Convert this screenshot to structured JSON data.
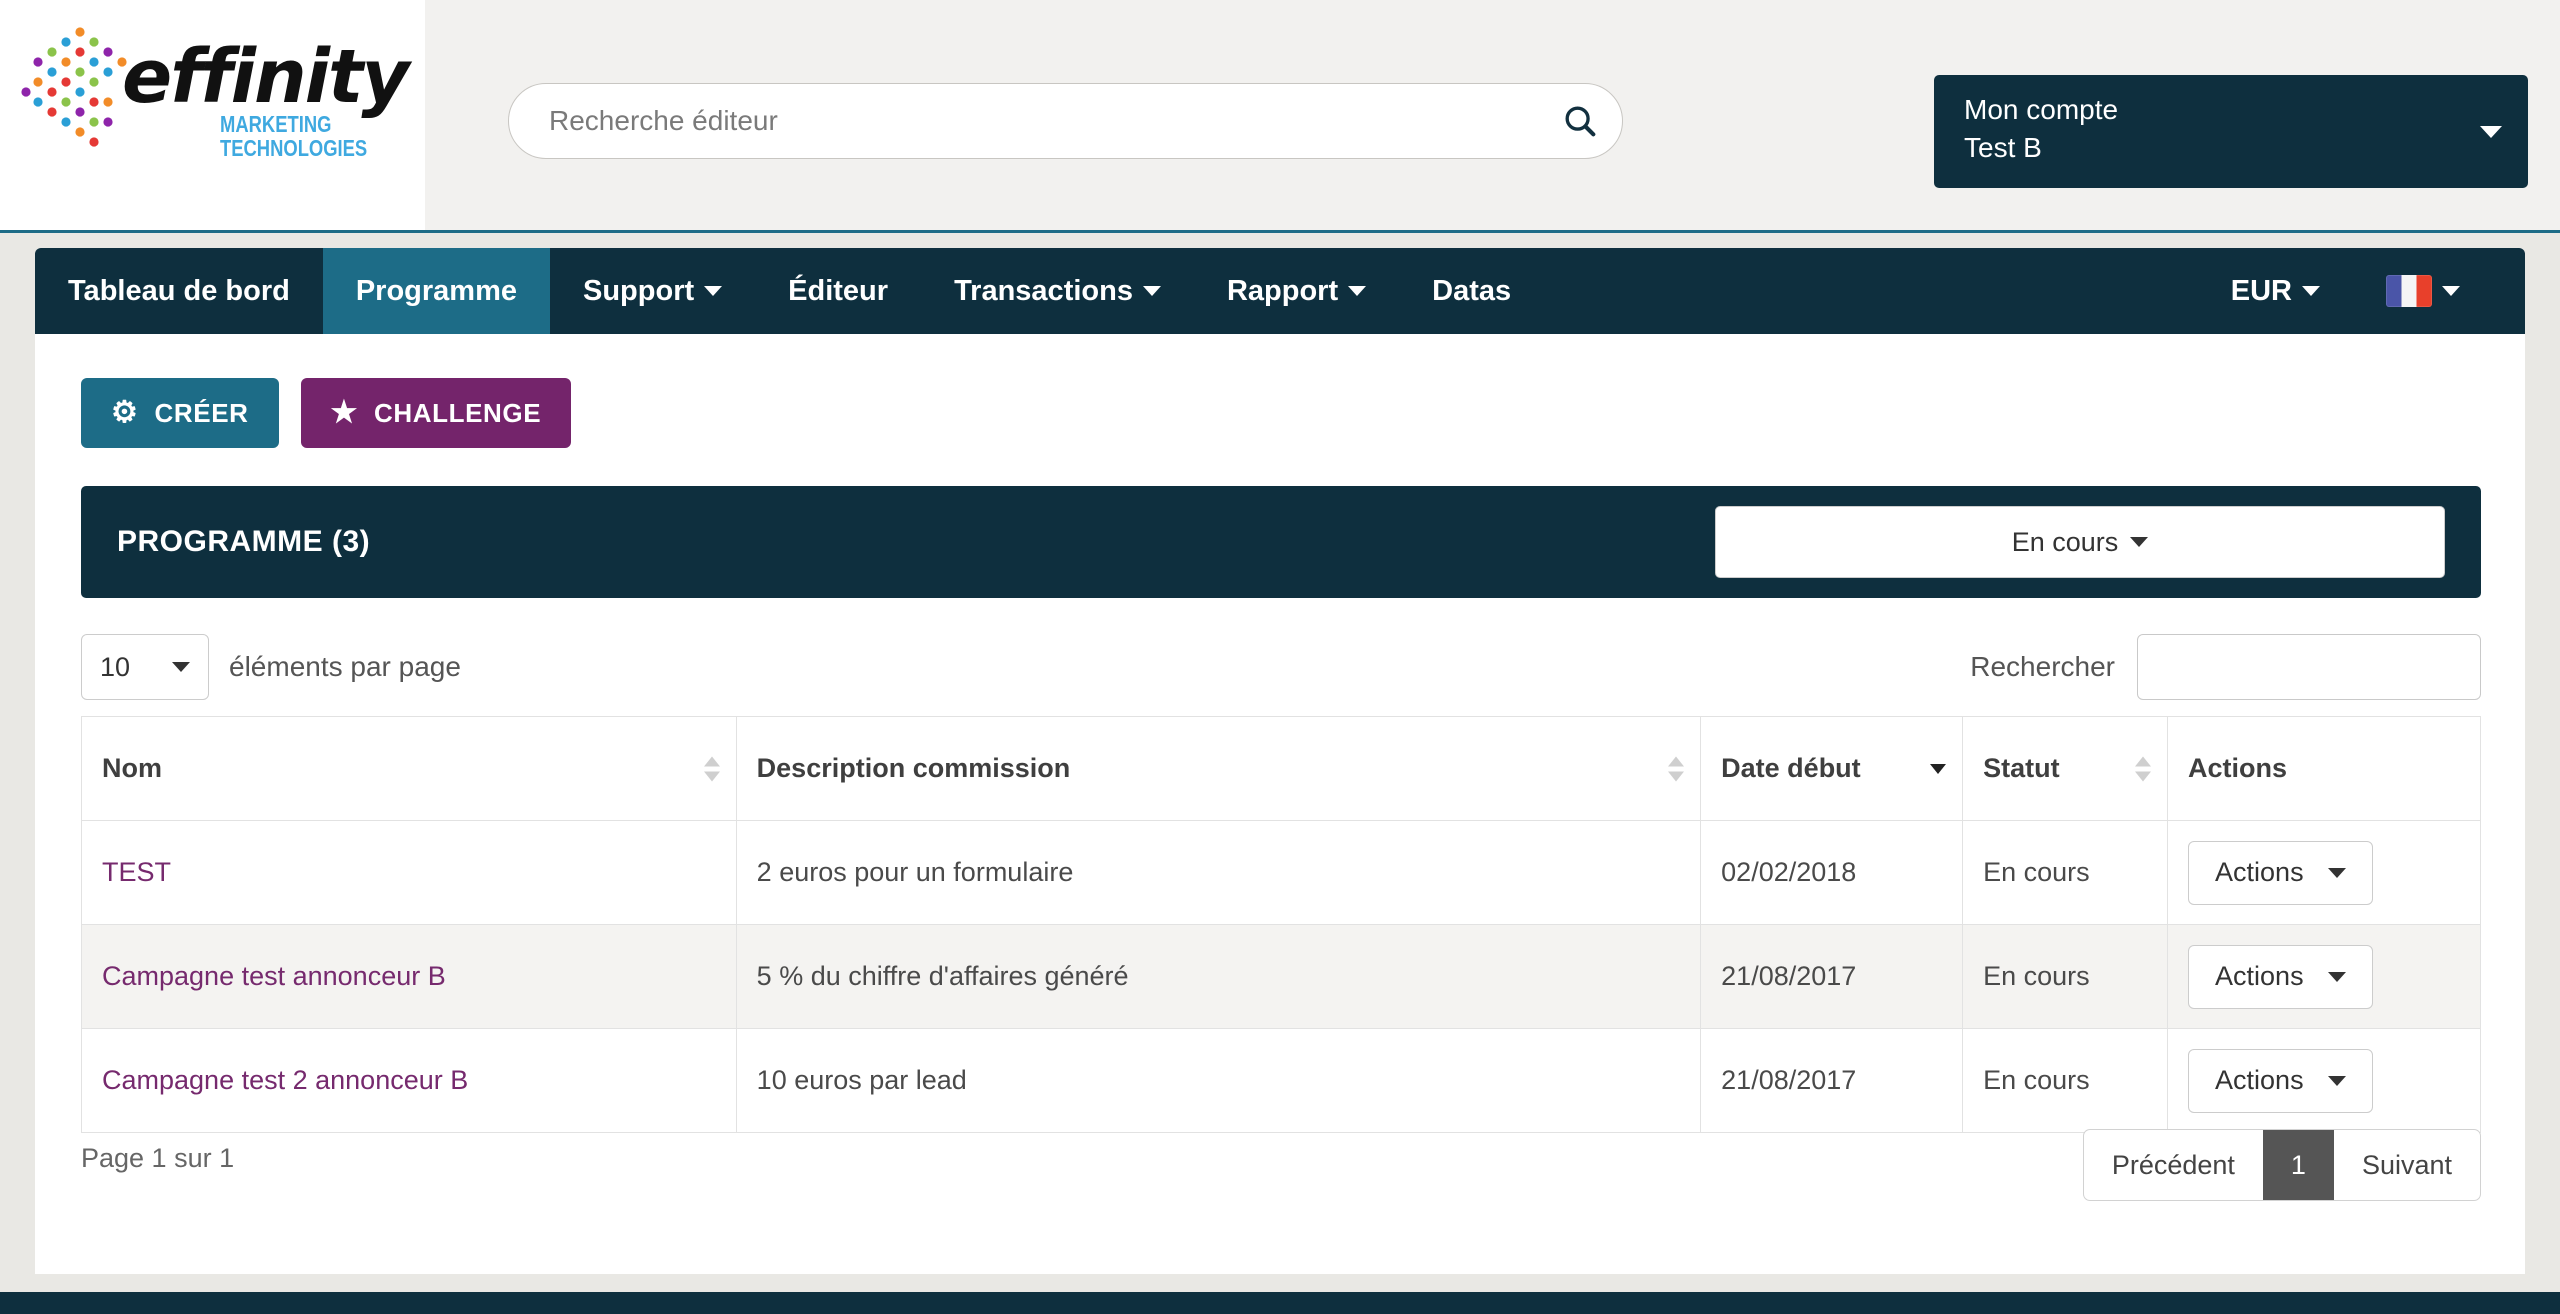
{
  "brand": {
    "name": "effinity",
    "tagline_line1": "MARKETING",
    "tagline_line2": "TECHNOLOGIES"
  },
  "header": {
    "search_placeholder": "Recherche éditeur",
    "search_value": "",
    "search_icon": "search-icon",
    "account_label": "Mon compte",
    "account_name": "Test B"
  },
  "nav": {
    "items": [
      {
        "label": "Tableau de bord",
        "active": false,
        "caret": false
      },
      {
        "label": "Programme",
        "active": true,
        "caret": false
      },
      {
        "label": "Support",
        "active": false,
        "caret": true
      },
      {
        "label": "Éditeur",
        "active": false,
        "caret": false
      },
      {
        "label": "Transactions",
        "active": false,
        "caret": true
      },
      {
        "label": "Rapport",
        "active": false,
        "caret": true
      },
      {
        "label": "Datas",
        "active": false,
        "caret": false
      }
    ],
    "currency": "EUR",
    "language_icon": "french-flag-icon"
  },
  "toolbar": {
    "create_label": "CRÉER",
    "create_icon": "gear-icon",
    "challenge_label": "CHALLENGE",
    "challenge_icon": "star-icon"
  },
  "panel": {
    "title": "PROGRAMME (3)",
    "status_filter": "En cours"
  },
  "filters": {
    "per_page_value": "10",
    "per_page_label": "éléments par page",
    "search_label": "Rechercher",
    "search_value": ""
  },
  "table": {
    "columns": [
      {
        "label": "Nom",
        "sort": "none"
      },
      {
        "label": "Description commission",
        "sort": "none"
      },
      {
        "label": "Date début",
        "sort": "desc"
      },
      {
        "label": "Statut",
        "sort": "none"
      },
      {
        "label": "Actions",
        "sort": "hidden"
      }
    ],
    "rows": [
      {
        "nom": "TEST",
        "description": "2 euros pour un formulaire",
        "date": "02/02/2018",
        "statut": "En cours",
        "action_label": "Actions"
      },
      {
        "nom": "Campagne test annonceur B",
        "description": "5 % du chiffre d'affaires généré",
        "date": "21/08/2017",
        "statut": "En cours",
        "action_label": "Actions"
      },
      {
        "nom": "Campagne test 2 annonceur B",
        "description": "10 euros par lead",
        "date": "21/08/2017",
        "statut": "En cours",
        "action_label": "Actions"
      }
    ]
  },
  "pagination": {
    "page_info": "Page 1 sur 1",
    "previous": "Précédent",
    "current": "1",
    "next": "Suivant"
  },
  "colors": {
    "navy": "#0e2f3e",
    "teal": "#1d6c87",
    "purple": "#74246b",
    "link_purple": "#762a6e",
    "header_bg": "#f2f1ef",
    "brand_blue": "#3fa9e0"
  }
}
